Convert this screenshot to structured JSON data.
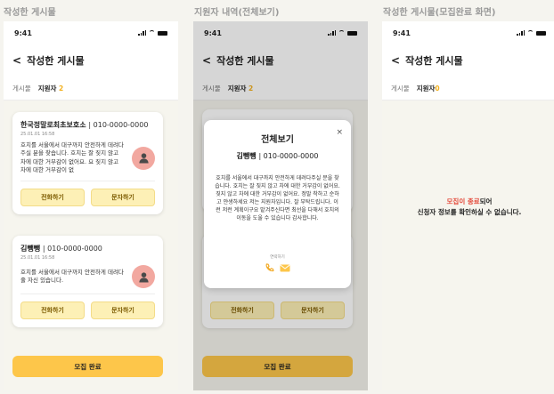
{
  "captions": [
    "작성한 게시물",
    "지원자 내역(전체보기)",
    "작성한 게시물(모집완료 화면)"
  ],
  "status_time": "9:41",
  "header_title": "작성한 게시물",
  "tabs": {
    "posts": "게시물",
    "applicants": "지원자",
    "count_active": "2",
    "count_done": "0"
  },
  "applicants": [
    {
      "name": "한국정말로최초보호소",
      "phone": "| 010-0000-0000",
      "date": "25.01.01  16:58",
      "message": "호치를 서울에서 대구까지 안전하게 데려다주실 분을 찾습니다. 호치는 잘 짖지 않고 차에 대한 거부감이 없어요. 요 짖지 않고 차에 대한 거부감이 없"
    },
    {
      "name": "김뺑뺑",
      "phone": "| 010-0000-0000",
      "date": "25.01.01  16:58",
      "message": "호치를 서울에서 대구까지 안전하게 데려다 줄 자신 있습니다."
    }
  ],
  "buttons": {
    "call": "전화하기",
    "text": "문자하기",
    "done": "모집 완료"
  },
  "modal": {
    "title": "전체보기",
    "close": "×",
    "name": "김뺑뺑",
    "phone": "| 010-0000-0000",
    "message": "호치를 서울에서 대구까지 안전하게 데려다주실 분을 찾습니다. 호치는 잘 짖지 않고 차에 대한 거부감이 없어요. 짖지 않고 차에 대한 거부감이 없어요. 정말 착하고 순하고 얀생하세요 저는 지원자입니다. 잘 부탁드립니다. 이런 저런 계획이구요 맡겨주신다면 최선을 다해서 호치의 이동을 도울 수 있습니다 감사합니다.",
    "contact_label": "연락하기"
  },
  "empty": {
    "accent": "모집이 종료",
    "rest1": "되어",
    "line2": "신청자 정보를 확인하실 수 없습니다."
  },
  "colors": {
    "accent": "#fdc64a",
    "count": "#f2b01e",
    "avatar": "#f2a8a0",
    "closed": "#e4493a"
  }
}
